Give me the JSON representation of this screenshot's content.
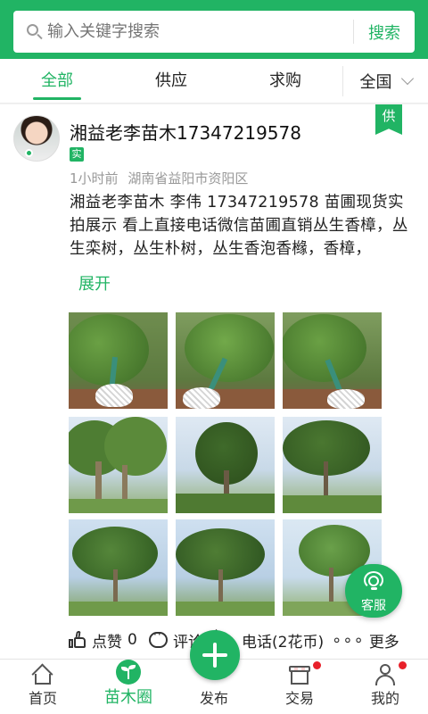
{
  "search": {
    "placeholder": "输入关键字搜索",
    "button_label": "搜索"
  },
  "tabs": [
    {
      "label": "全部",
      "active": true
    },
    {
      "label": "供应",
      "active": false
    },
    {
      "label": "求购",
      "active": false
    }
  ],
  "region_filter": {
    "label": "全国",
    "icon": "chevron-down-icon"
  },
  "post": {
    "author": "湘益老李苗木17347219578",
    "verified_badge": "实",
    "type_tag": "供",
    "time": "1小时前",
    "location": "湖南省益阳市资阳区",
    "text": "湘益老李苗木 李伟 17347219578  苗圃现货实拍展示  看上直接电话微信苗圃直销丛生香樟，丛生栾树，丛生朴树，丛生香泡香橼，香樟，",
    "expand_label": "展开",
    "photo_count": 9
  },
  "actions": {
    "like_label": "点赞",
    "like_count": "0",
    "comment_label": "评论",
    "phone_label": "电话(2花币)",
    "more_label": "更多"
  },
  "customer_service": {
    "label": "客服",
    "icon": "headset-icon"
  },
  "bottom_nav": {
    "items": [
      {
        "label": "首页",
        "icon": "home-icon",
        "active": false,
        "badge": false
      },
      {
        "label": "苗木圈",
        "icon": "seedling-icon",
        "active": true,
        "badge": false
      },
      {
        "label": "发布",
        "icon": "plus-icon",
        "active": false,
        "badge": false
      },
      {
        "label": "交易",
        "icon": "shop-icon",
        "active": false,
        "badge": true
      },
      {
        "label": "我的",
        "icon": "person-icon",
        "active": false,
        "badge": true
      }
    ]
  },
  "colors": {
    "brand_green": "#21b464",
    "badge_red": "#e8202a"
  }
}
